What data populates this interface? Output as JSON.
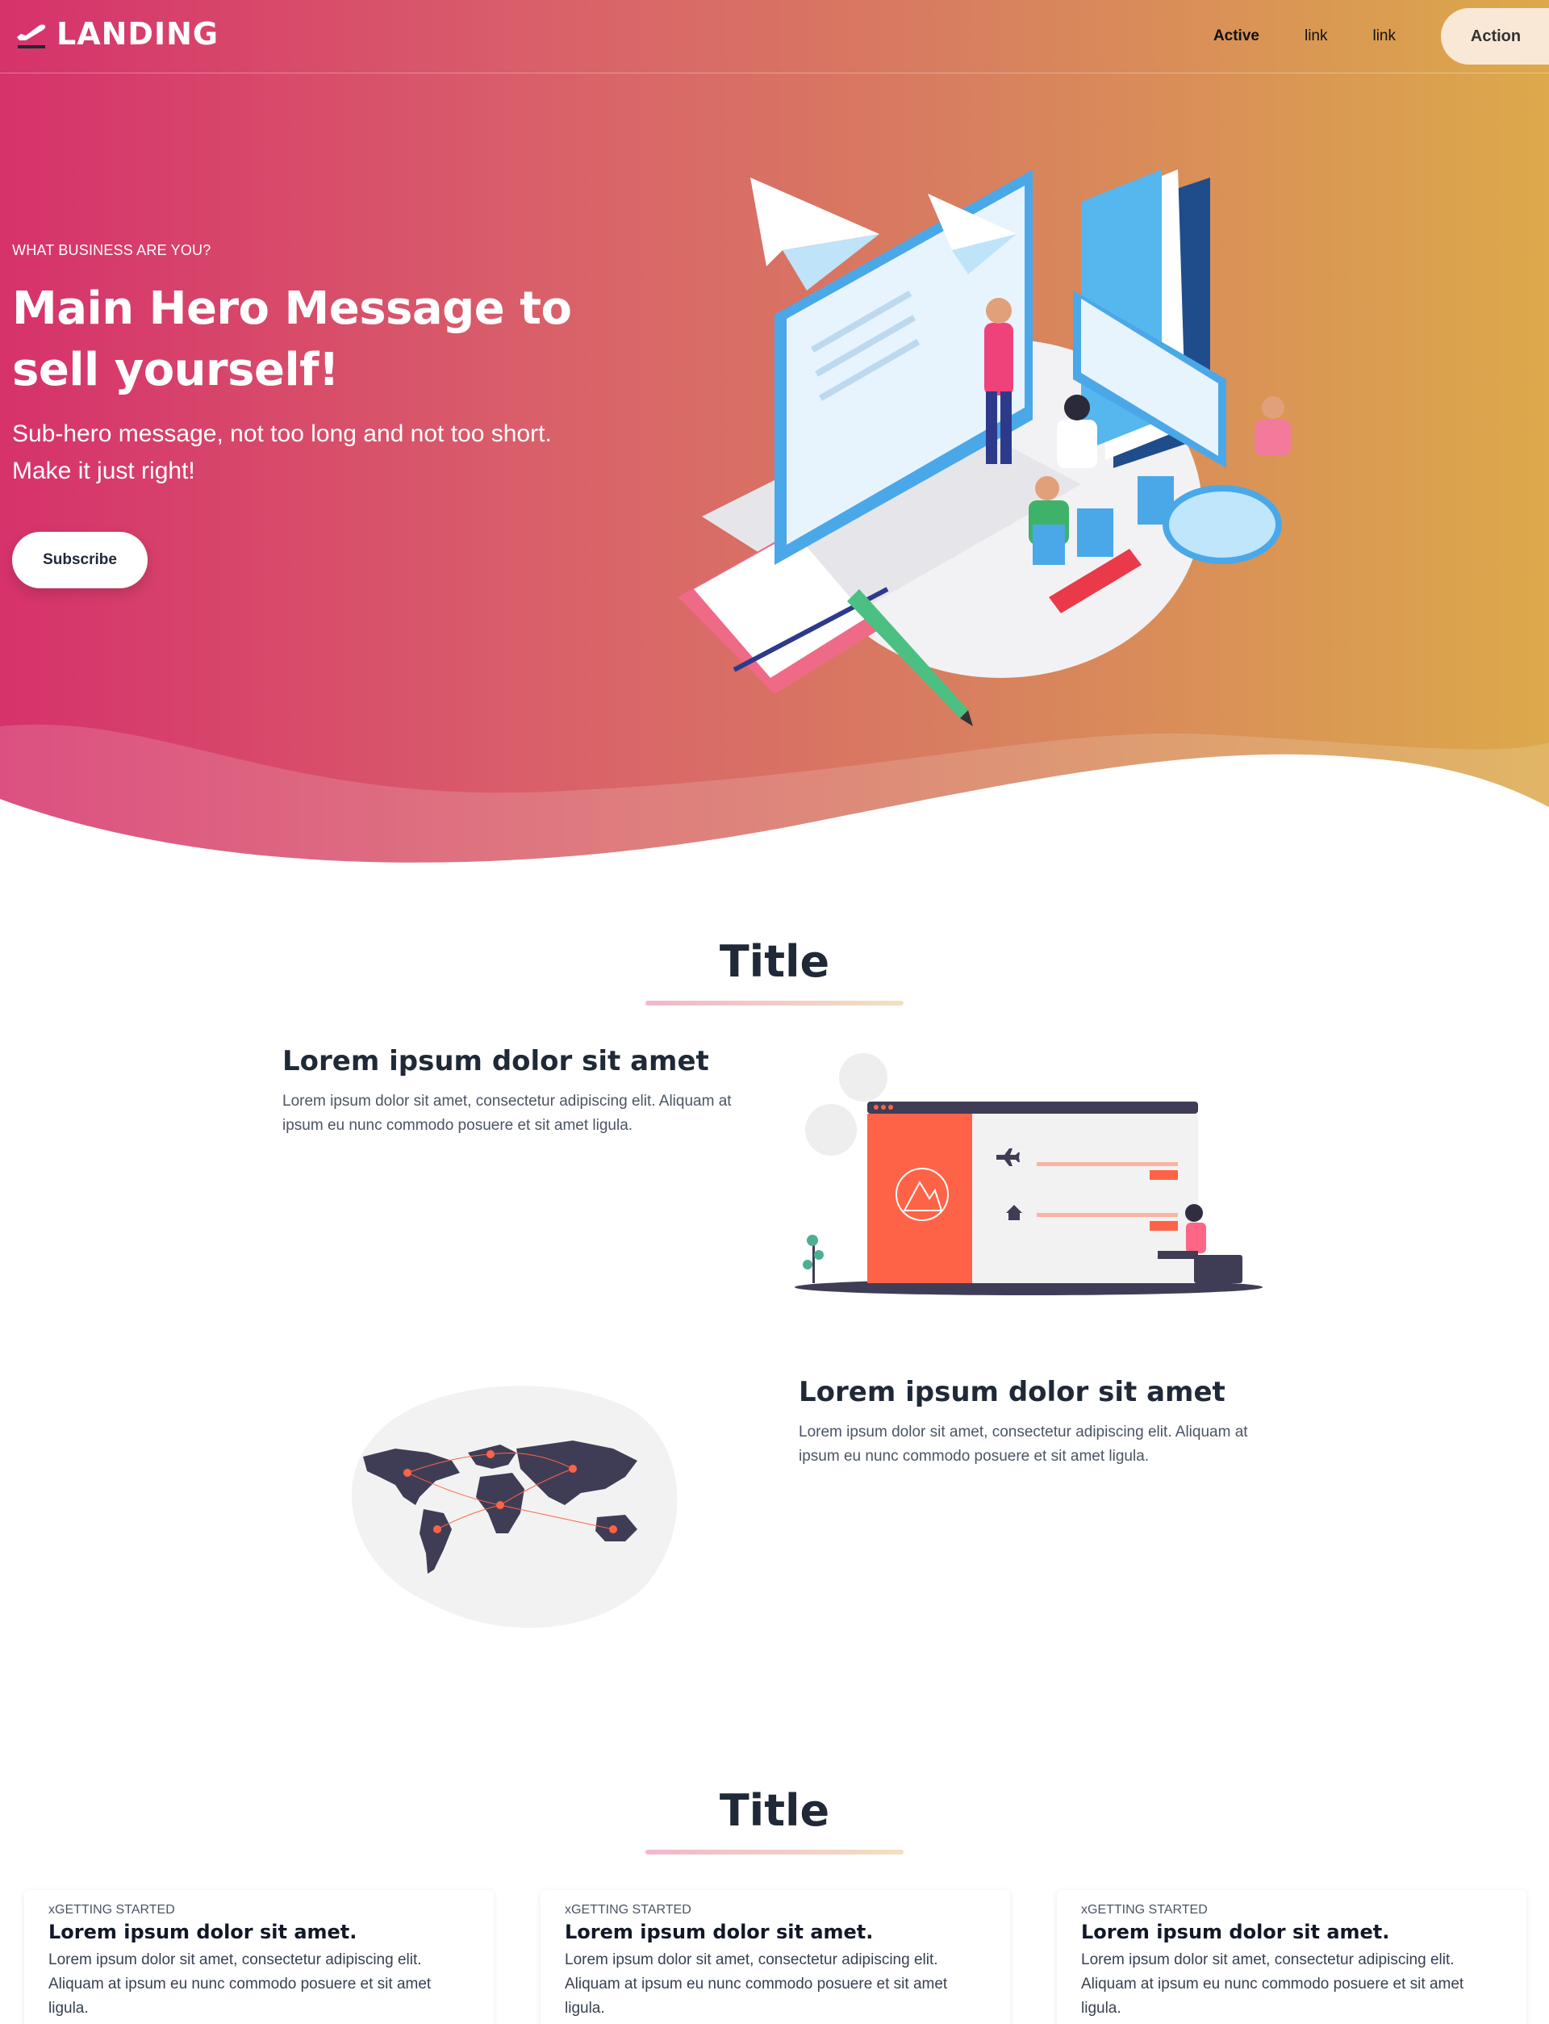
{
  "nav": {
    "brand": "LANDING",
    "links": [
      {
        "label": "Active",
        "active": true
      },
      {
        "label": "link",
        "active": false
      },
      {
        "label": "link",
        "active": false
      }
    ],
    "action_label": "Action"
  },
  "hero": {
    "eyebrow": "WHAT BUSINESS ARE YOU?",
    "title": "Main Hero Message to sell yourself!",
    "subtitle": "Sub-hero message, not too long and not too short. Make it just right!",
    "cta_label": "Subscribe"
  },
  "section1": {
    "title": "Title",
    "features": [
      {
        "heading": "Lorem ipsum dolor sit amet",
        "body": "Lorem ipsum dolor sit amet, consectetur adipiscing elit. Aliquam at ipsum eu nunc commodo posuere et sit amet ligula."
      },
      {
        "heading": "Lorem ipsum dolor sit amet",
        "body": "Lorem ipsum dolor sit amet, consectetur adipiscing elit. Aliquam at ipsum eu nunc commodo posuere et sit amet ligula."
      }
    ]
  },
  "section2": {
    "title": "Title",
    "cards": [
      {
        "eyebrow": "xGETTING STARTED",
        "title": "Lorem ipsum dolor sit amet.",
        "body": "Lorem ipsum dolor sit amet, consectetur adipiscing elit. Aliquam at ipsum eu nunc commodo posuere et sit amet ligula."
      },
      {
        "eyebrow": "xGETTING STARTED",
        "title": "Lorem ipsum dolor sit amet.",
        "body": "Lorem ipsum dolor sit amet, consectetur adipiscing elit. Aliquam at ipsum eu nunc commodo posuere et sit amet ligula."
      },
      {
        "eyebrow": "xGETTING STARTED",
        "title": "Lorem ipsum dolor sit amet.",
        "body": "Lorem ipsum dolor sit amet, consectetur adipiscing elit. Aliquam at ipsum eu nunc commodo posuere et sit amet ligula."
      }
    ]
  },
  "icons": {
    "brand": "plane-departure-icon",
    "feature1_plane": "plane-icon",
    "feature1_home": "home-icon"
  },
  "colors": {
    "gradient_start": "#d6326b",
    "gradient_end": "#dca94b",
    "accent_orange": "#ff6347",
    "text_dark": "#1f2937"
  }
}
